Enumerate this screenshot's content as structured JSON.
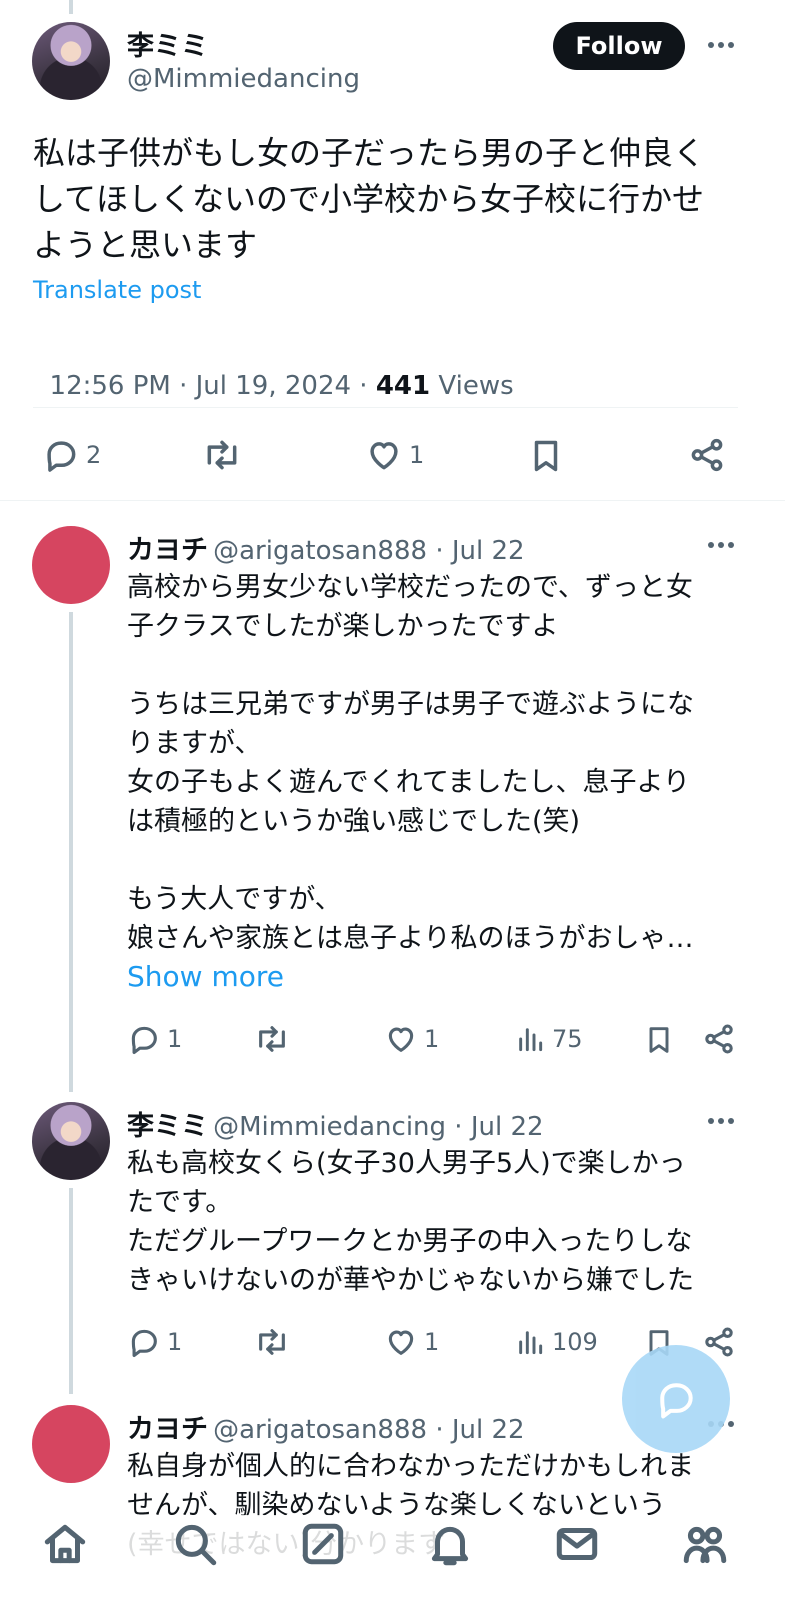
{
  "main_post": {
    "author_name": "李ミミ",
    "author_handle": "@Mimmiedancing",
    "follow_label": "Follow",
    "text": "私は子供がもし女の子だったら男の子と仲良くしてほしくないので小学校から女子校に行かせようと思います",
    "text_lines": [
      "私は子供がもし女の子だったら男の子と仲良く",
      "してほしくないので小学校から女子校に行かせ",
      "ようと思います"
    ],
    "translate_label": "Translate post",
    "timestamp": "12:56 PM · Jul 19, 2024 · ",
    "views_count": "441",
    "views_label": " Views",
    "replies": "2",
    "likes": "1"
  },
  "replies": [
    {
      "author_name": "カヨチ",
      "author_handle": "@arigatosan888 · Jul 22",
      "text": "高校から男女少ない学校だったので、ずっと女\n子クラスでしたが楽しかったですよ\n\nうちは三兄弟ですが男子は男子で遊ぶようにな\nりますが、\n女の子もよく遊んでくれてましたし、息子より\nは積極的というか強い感じでした(笑)\n\nもう大人ですが、\n娘さんや家族とは息子より私のほうがおしゃ…",
      "show_more": "Show more",
      "replies": "1",
      "likes": "1",
      "views": "75"
    },
    {
      "author_name": "李ミミ",
      "author_handle": "@Mimmiedancing · Jul 22",
      "text": "私も高校女くら(女子30人男子5人)で楽しかっ\nたです。\nただグループワークとか男子の中入ったりしな\nきゃいけないのが華やかじゃないから嫌でした",
      "replies": "1",
      "likes": "1",
      "views": "109"
    },
    {
      "author_name": "カヨチ",
      "author_handle": "@arigatosan888 · Jul 22",
      "text": "私自身が個人的に合わなかっただけかもしれま\nせんが、馴染めないような楽しくないという\n(幸せではない)分かります"
    }
  ],
  "icons": {
    "more": "more-icon",
    "reply": "reply-icon",
    "repost": "repost-icon",
    "like": "heart-icon",
    "views": "views-chart-icon",
    "bookmark": "bookmark-icon",
    "share": "share-icon",
    "compose": "compose-icon",
    "nav": [
      "home-icon",
      "search-icon",
      "grok-icon",
      "notifications-icon",
      "messages-icon",
      "communities-icon"
    ]
  },
  "colors": {
    "accent": "#1d9bf0",
    "text": "#0f1419",
    "muted": "#536471",
    "avatar_red": "#d64560"
  }
}
